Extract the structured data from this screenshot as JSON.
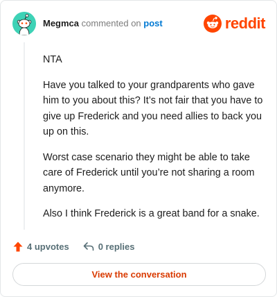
{
  "header": {
    "username": "Megmca",
    "action": "commented on",
    "target": "post",
    "brand": "reddit"
  },
  "comment": {
    "paragraphs": [
      "NTA",
      "Have you talked to your grandparents who gave him to you about this? It’s not fair that you have to give up Frederick and you need allies to back you up on this.",
      "Worst case scenario they might be able to take care of Frederick until you’re not sharing a room anymore.",
      "Also I think Frederick is a great band for a snake."
    ]
  },
  "footer": {
    "upvotes": "4 upvotes",
    "replies": "0 replies",
    "view_button": "View the conversation"
  },
  "colors": {
    "avatar_bg": "#3ed2b6",
    "brand": "#ff4500",
    "link": "#0079d3",
    "button_text": "#d93a00"
  },
  "icons": {
    "avatar": "snoo-avatar-icon",
    "brand": "reddit-logo-icon",
    "upvote": "upvote-arrow-icon",
    "reply": "reply-arrow-icon"
  }
}
